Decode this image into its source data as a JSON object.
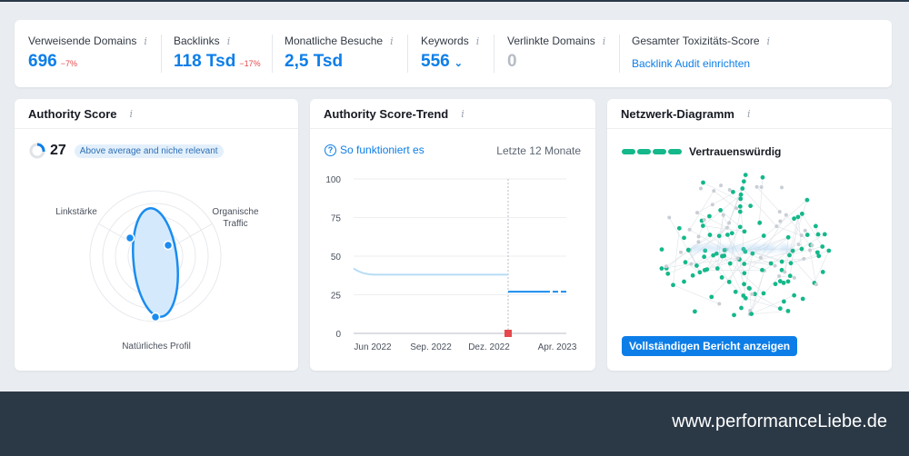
{
  "stats": [
    {
      "label": "Verweisende Domains",
      "value": "696",
      "change": "−7%"
    },
    {
      "label": "Backlinks",
      "value": "118 Tsd",
      "change": "−17%"
    },
    {
      "label": "Monatliche Besuche",
      "value": "2,5 Tsd"
    },
    {
      "label": "Keywords",
      "value": "556"
    },
    {
      "label": "Verlinkte Domains",
      "value": "0"
    },
    {
      "label": "Gesamter Toxizitäts-Score",
      "link": "Backlink Audit einrichten"
    }
  ],
  "authority": {
    "title": "Authority Score",
    "score": "27",
    "badge": "Above average and niche relevant",
    "axes": [
      "Linkstärke",
      "Organische",
      "Traffic",
      "Natürliches Profil"
    ],
    "score_fraction": 0.27
  },
  "trend": {
    "title": "Authority Score-Trend",
    "help": "So funktioniert es",
    "period": "Letzte 12 Monate",
    "yticks": [
      "100",
      "75",
      "50",
      "25",
      "0"
    ],
    "xticks": [
      "Jun 2022",
      "Sep. 2022",
      "Dez. 2022",
      "Apr. 2023"
    ]
  },
  "network": {
    "title": "Netzwerk-Diagramm",
    "legend": "Vertrauenswürdig",
    "button": "Vollständigen Bericht anzeigen",
    "blurred": "performanceliebe.de"
  },
  "footer": {
    "url": "www.performanceLiebe.de"
  },
  "colors": {
    "accent": "#0d7ee8",
    "trusted": "#14b88a",
    "negative": "#e5484d",
    "footer": "#2b3947"
  },
  "chart_data": {
    "type": "line",
    "title": "Authority Score-Trend",
    "xlabel": "",
    "ylabel": "",
    "x": [
      "Jun 2022",
      "Sep. 2022",
      "Dez. 2022",
      "Apr. 2023"
    ],
    "ylim": [
      0,
      100
    ],
    "yticks": [
      0,
      25,
      50,
      75,
      100
    ],
    "series": [
      {
        "values": [
          42,
          38,
          38,
          38
        ]
      },
      {
        "values": [
          null,
          null,
          27,
          27
        ]
      }
    ],
    "grid": true
  }
}
